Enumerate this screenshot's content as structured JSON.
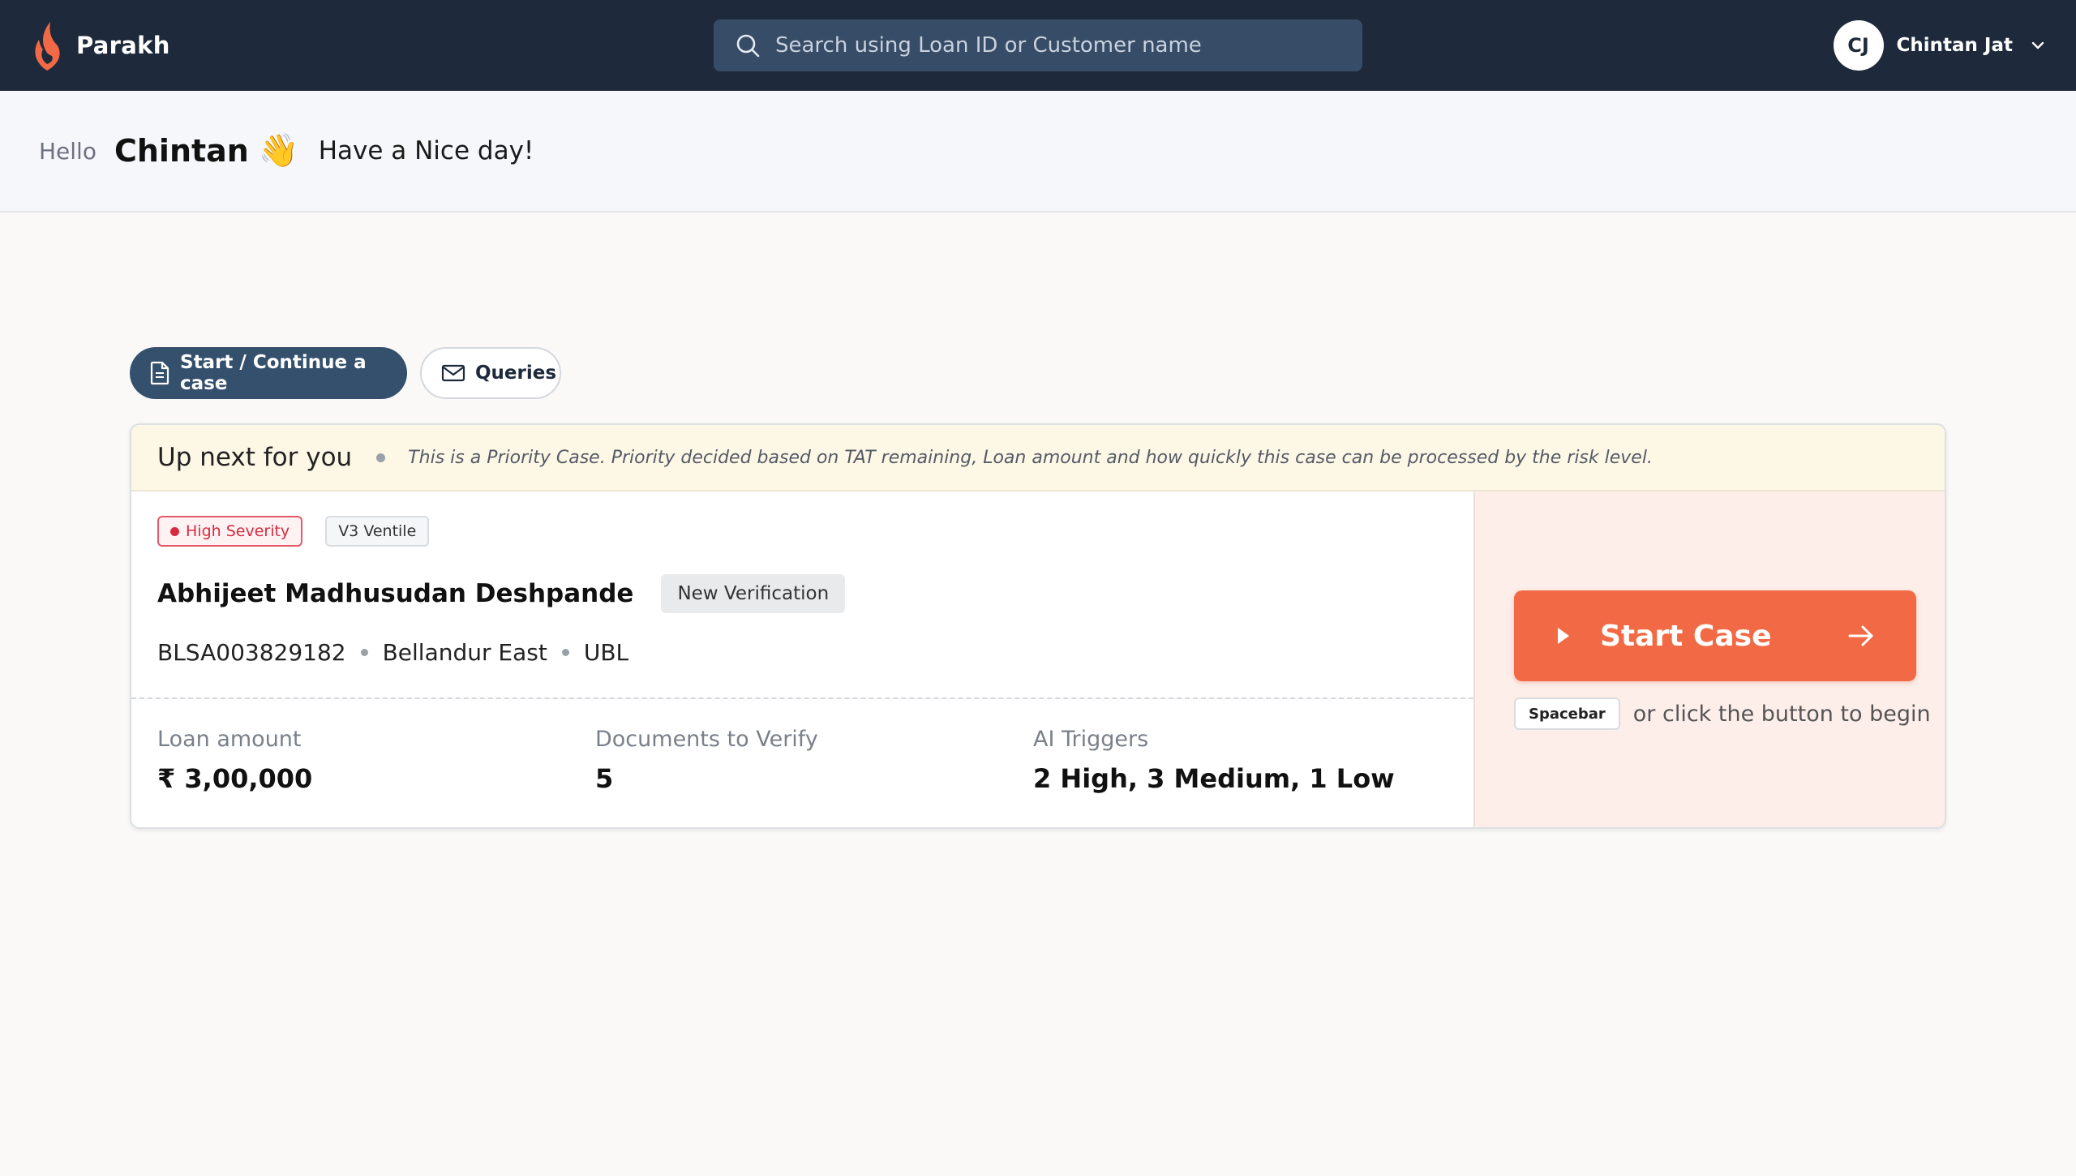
{
  "header": {
    "brand_name": "Parakh",
    "search_placeholder": "Search using Loan ID or Customer name",
    "user_initials": "CJ",
    "user_name": "Chintan Jat"
  },
  "greeting": {
    "hello": "Hello",
    "name": "Chintan",
    "emoji": "👋",
    "message": "Have a Nice day!"
  },
  "tabs": [
    {
      "label": "Start / Continue a case",
      "icon": "document-icon",
      "active": true
    },
    {
      "label": "Queries",
      "icon": "mail-icon",
      "active": false
    }
  ],
  "card": {
    "title": "Up next for you",
    "priority_note": "This is a Priority Case. Priority decided based on TAT remaining, Loan amount and how quickly this case can be processed by the risk level.",
    "tags": {
      "severity": "High Severity",
      "ventile": "V3 Ventile"
    },
    "customer_name": "Abhijeet Madhusudan Deshpande",
    "verification_badge": "New Verification",
    "meta": [
      "BLSA003829182",
      "Bellandur East",
      "UBL"
    ],
    "stats": [
      {
        "label": "Loan amount",
        "value": "₹ 3,00,000"
      },
      {
        "label": "Documents to Verify",
        "value": "5"
      },
      {
        "label": "AI Triggers",
        "value": "2 High, 3 Medium, 1 Low"
      }
    ],
    "start_button": "Start Case",
    "shortcut_key": "Spacebar",
    "shortcut_hint": "or click the button to begin"
  },
  "colors": {
    "topbar": "#1e2a3b",
    "accent": "#f26a45",
    "tab_active": "#35506d",
    "severity": "#d42b40"
  }
}
